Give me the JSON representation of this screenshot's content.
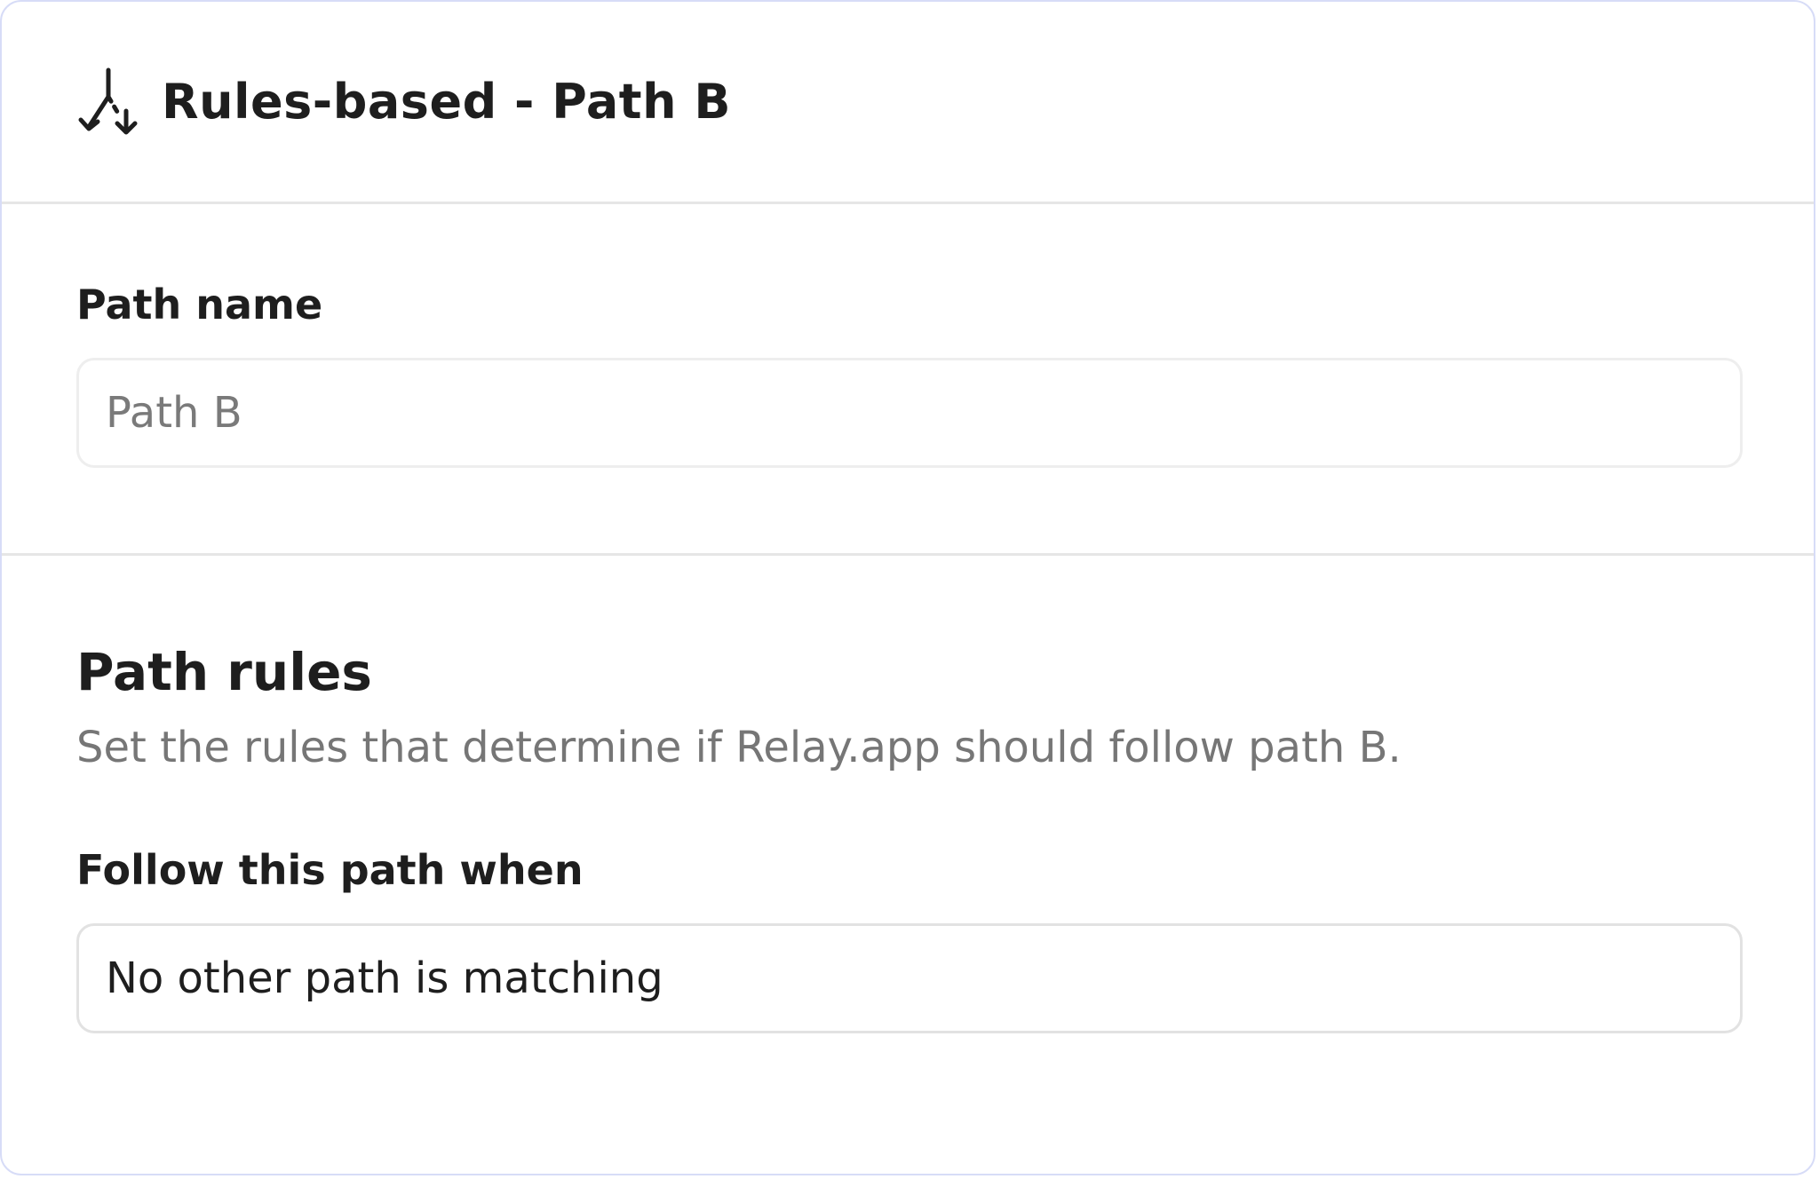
{
  "header": {
    "icon": "split-path-icon",
    "title": "Rules-based - Path B"
  },
  "path_name": {
    "label": "Path name",
    "value": "",
    "placeholder": "Path B"
  },
  "path_rules": {
    "title": "Path rules",
    "description": "Set the rules that determine if Relay.app should follow path B.",
    "condition_label": "Follow this path when",
    "condition_value": "No other path is matching"
  },
  "colors": {
    "panel_border": "#d7dcf7",
    "divider": "#e6e6e6",
    "muted_text": "#767676",
    "text": "#1e1e1e"
  }
}
